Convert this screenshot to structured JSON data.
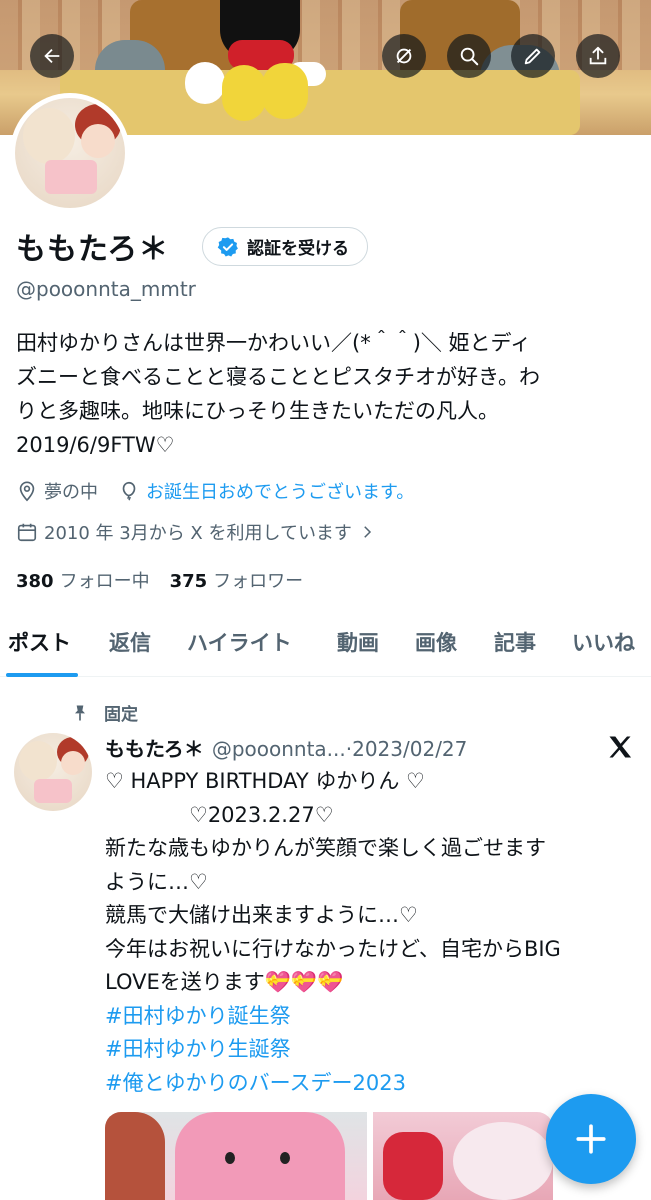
{
  "header": {
    "back_icon": "arrow-left-icon",
    "actions": [
      "mute-icon",
      "search-icon",
      "edit-icon",
      "share-icon"
    ]
  },
  "profile": {
    "display_name": "ももたろ＊",
    "verify_label": "認証を受ける",
    "handle": "@pooonnta_mmtr",
    "bio_lines": [
      "田村ゆかりさんは世界一かわいい／(*＾＾)＼ 姫とディ",
      "ズニーと食べることと寝ることとピスタチオが好き。わ",
      "りと多趣味。地味にひっそり生きたいただの凡人。",
      "2019/6/9FTW♡"
    ],
    "location": "夢の中",
    "birthday_text": "お誕生日おめでとうございます。",
    "joined": "2010 年 3月から X を利用しています",
    "following_count": "380",
    "following_label": "フォロー中",
    "followers_count": "375",
    "followers_label": "フォロワー"
  },
  "tabs": [
    "ポスト",
    "返信",
    "ハイライト",
    "動画",
    "画像",
    "記事",
    "いいね"
  ],
  "pinned_post": {
    "pinned_label": "固定",
    "author_name": "ももたろ＊",
    "author_handle": "@pooonnta...",
    "date": "·2023/02/27",
    "lines": [
      "♡ HAPPY BIRTHDAY ゆかりん ♡",
      "　　　　♡2023.2.27♡",
      "新たな歳もゆかりんが笑顔で楽しく過ごせます",
      "ように…♡",
      "競馬で大儲け出来ますように…♡",
      "今年はお祝いに行けなかったけど、自宅からBIG",
      "LOVEを送ります💝💝💝"
    ],
    "hashtags": [
      "#田村ゆかり誕生祭",
      "#田村ゆかり生誕祭",
      "#俺とゆかりのバースデー2023"
    ]
  },
  "colors": {
    "accent": "#1d9bf0",
    "text": "#0f1419",
    "secondary": "#536471"
  }
}
